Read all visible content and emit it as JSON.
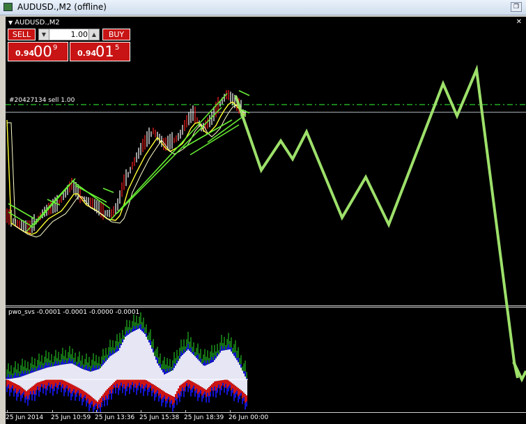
{
  "window": {
    "title": "AUDUSD.,M2 (offline)"
  },
  "chart": {
    "symbol_label": "AUDUSD.,M2",
    "trade_label": "#20427134 sell 1.00",
    "indicator_label": "pwo_svs -0.0001 -0.0001 -0.0000 -0.0001"
  },
  "trade_panel": {
    "sell_label": "SELL",
    "buy_label": "BUY",
    "lot": "1.00",
    "bid": {
      "small": "0.94",
      "big": "00",
      "sup": "9"
    },
    "ask": {
      "small": "0.94",
      "big": "01",
      "sup": "5"
    }
  },
  "time_axis": [
    "25 Jun 2014",
    "25 Jun 10:59",
    "25 Jun 13:36",
    "25 Jun 15:38",
    "25 Jun 18:39",
    "26 Jun 00:00"
  ],
  "colors": {
    "chart_bg": "#000000",
    "trade_button": "#c81414",
    "drawn_line": "#9de06a",
    "ma_line": "#ffff33",
    "channel_lines": "#66ee33",
    "hist_red": "#ff1a1a",
    "hist_blue": "#1a1aff",
    "hist_green": "#1a8a1a",
    "hist_fill": "#e6e6f4"
  }
}
